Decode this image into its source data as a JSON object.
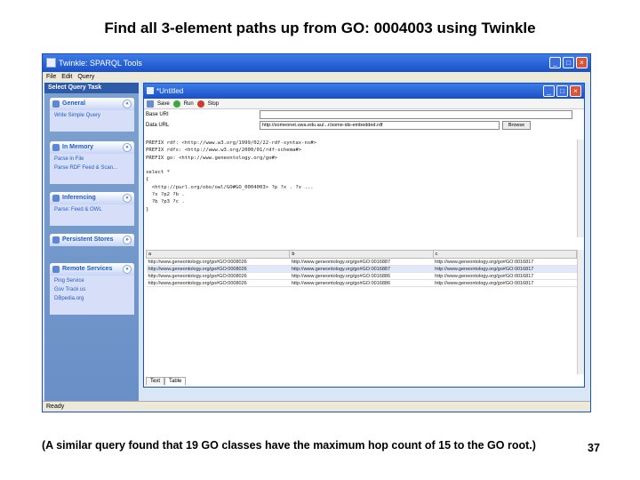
{
  "slide": {
    "title": "Find all 3-element paths up from GO: 0004003 using Twinkle",
    "caption": "(A similar query found that 19 GO classes have the maximum hop count of 15 to the GO root.)",
    "page_number": "37"
  },
  "app": {
    "title": "Twinkle: SPARQL Tools",
    "menu": [
      "File",
      "Edit",
      "Query"
    ],
    "status": "Ready"
  },
  "taskpane": {
    "header": "Select Query Task",
    "groups": [
      {
        "label": "General",
        "items": [
          "Write Simple Query"
        ]
      },
      {
        "label": "In Memory",
        "items": [
          "Parse in File",
          "Parse RDF Feed & Scan..."
        ]
      },
      {
        "label": "Inferencing",
        "items": [
          "Parse: Feed & OWL"
        ]
      },
      {
        "label": "Persistent Stores",
        "items": []
      },
      {
        "label": "Remote Services",
        "items": [
          "Ping Service",
          "Gov Track us",
          "DBpedia.org"
        ]
      }
    ]
  },
  "frame": {
    "title": "*Untitled",
    "toolbar": [
      "Save",
      "Run",
      "Stop"
    ],
    "base_uri_label": "Base URI",
    "base_uri_value": "",
    "data_url_label": "Data URL",
    "data_url_value": "http://someonet.uwa.edu.au/...r/some-ids-embedded.rdf",
    "browse_label": "Browse",
    "query_text": "PREFIX rdf: <http://www.w3.org/1999/02/22-rdf-syntax-ns#>\nPREFIX rdfs: <http://www.w3.org/2000/01/rdf-schema#>\nPREFIX go: <http://www.geneontology.org/go#>\n\nselect *\n{\n  <http://purl.org/obo/owl/GO#GO_0004003> ?p ?x . ?x ...\n  ?x ?p2 ?b .\n  ?b ?p3 ?c .\n}",
    "results": {
      "columns": [
        "a",
        "b",
        "c"
      ],
      "rows": [
        [
          "http://www.geneontology.org/go#GO:0008026",
          "http://www.geneontology.org/go#GO:0016887",
          "http://www.geneontology.org/go#GO:0016817"
        ],
        [
          "http://www.geneontology.org/go#GO:0008026",
          "http://www.geneontology.org/go#GO:0016887",
          "http://www.geneontology.org/go#GO:0016817"
        ],
        [
          "http://www.geneontology.org/go#GO:0008026",
          "http://www.geneontology.org/go#GO:0016886",
          "http://www.geneontology.org/go#GO:0016817"
        ],
        [
          "http://www.geneontology.org/go#GO:0008026",
          "http://www.geneontology.org/go#GO:0016886",
          "http://www.geneontology.org/go#GO:0016817"
        ]
      ]
    },
    "tabs": [
      "Text",
      "Table"
    ]
  }
}
